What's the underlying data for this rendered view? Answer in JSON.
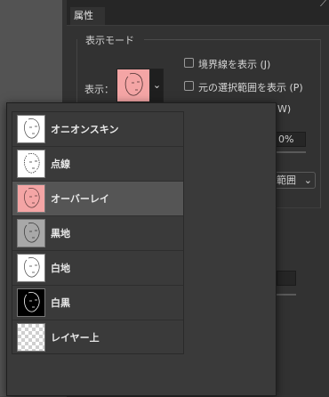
{
  "panel": {
    "tab_label": "属性",
    "group_title": "表示モード",
    "display_label": "表示：",
    "dropdown_glyph": "⌄",
    "checkboxes": [
      {
        "label": "境界線を表示 (J)",
        "checked": false
      },
      {
        "label": "元の選択範囲を表示 (P)",
        "checked": false
      }
    ],
    "partial_shortcut": "W)",
    "opacity_value": "0%",
    "range_select_value": "範囲",
    "range_select_glyph": "⌄"
  },
  "popup": {
    "selected_index": 2,
    "items": [
      {
        "label": "オニオンスキン",
        "thumb": "onion-skin",
        "bg": "#ffffff"
      },
      {
        "label": "点線",
        "thumb": "marching-ants",
        "bg": "#ffffff"
      },
      {
        "label": "オーバーレイ",
        "thumb": "overlay",
        "bg": "#f4a5a5"
      },
      {
        "label": "黒地",
        "thumb": "on-black",
        "bg": "#aaaaaa"
      },
      {
        "label": "白地",
        "thumb": "on-white",
        "bg": "#ffffff"
      },
      {
        "label": "白黒",
        "thumb": "black-white",
        "bg": "#000000"
      },
      {
        "label": "レイヤー上",
        "thumb": "on-layers",
        "bg": "checker"
      }
    ]
  }
}
